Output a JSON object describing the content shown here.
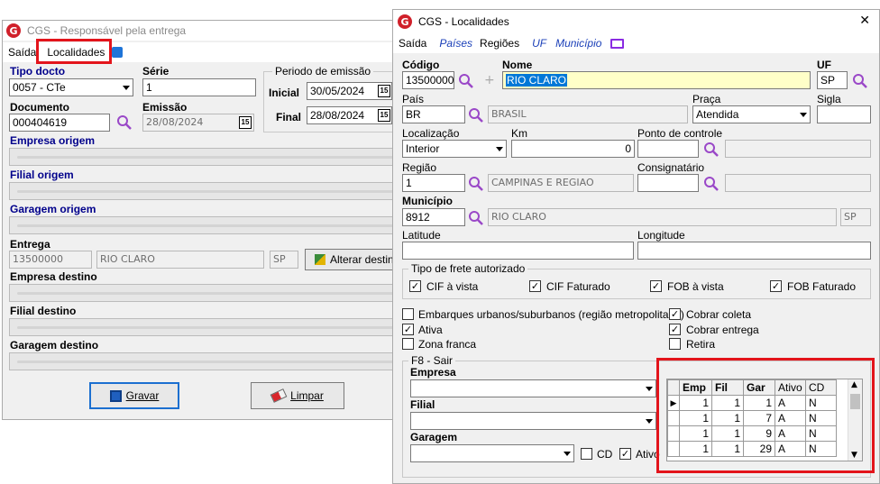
{
  "back": {
    "title": "CGS - Responsável pela entrega",
    "menu": [
      "Saída",
      "Localidades"
    ],
    "tipo_docto": {
      "label": "Tipo docto",
      "value": "0057 - CTe"
    },
    "serie": {
      "label": "Série",
      "value": "1"
    },
    "periodo": {
      "label": "Periodo de emissão",
      "inicial_label": "Inicial",
      "inicial": "30/05/2024",
      "final_label": "Final",
      "final": "28/08/2024"
    },
    "documento": {
      "label": "Documento",
      "value": "000404619"
    },
    "emissao": {
      "label": "Emissão",
      "value": "28/08/2024"
    },
    "empresa_origem": "Empresa origem",
    "filial_origem": "Filial origem",
    "garagem_origem": "Garagem origem",
    "entrega": {
      "label": "Entrega",
      "code": "13500000",
      "city": "RIO CLARO",
      "uf": "SP",
      "button": "Alterar destino"
    },
    "empresa_destino": "Empresa destino",
    "filial_destino": "Filial destino",
    "garagem_destino": "Garagem destino",
    "gravar": "Gravar",
    "limpar": "Limpar",
    "calendar_glyph": "15"
  },
  "front": {
    "title": "CGS - Localidades",
    "close": "✕",
    "menu": [
      {
        "label": "Saída",
        "style": "normal"
      },
      {
        "label": "Países",
        "style": "link"
      },
      {
        "label": "Regiões",
        "style": "normal"
      },
      {
        "label": "UF",
        "style": "link"
      },
      {
        "label": "Município",
        "style": "link"
      }
    ],
    "codigo": {
      "label": "Código",
      "value": "13500000"
    },
    "nome": {
      "label": "Nome",
      "value": "RIO CLARO"
    },
    "uf": {
      "label": "UF",
      "value": "SP"
    },
    "pais": {
      "label": "País",
      "code": "BR",
      "name": "BRASIL"
    },
    "praca": {
      "label": "Praça",
      "value": "Atendida"
    },
    "sigla": {
      "label": "Sigla",
      "value": ""
    },
    "localizacao": {
      "label": "Localização",
      "value": "Interior"
    },
    "km": {
      "label": "Km",
      "value": "0"
    },
    "ponto": {
      "label": "Ponto de controle",
      "value": ""
    },
    "regiao": {
      "label": "Região",
      "code": "1",
      "name": "CAMPINAS E REGIAO"
    },
    "consignatario": {
      "label": "Consignatário",
      "value": ""
    },
    "municipio": {
      "label": "Município",
      "code": "8912",
      "name": "RIO CLARO",
      "uf": "SP"
    },
    "latitude": {
      "label": "Latitude",
      "value": ""
    },
    "longitude": {
      "label": "Longitude",
      "value": ""
    },
    "frete": {
      "title": "Tipo de frete autorizado",
      "items": [
        {
          "label": "CIF à vista",
          "checked": true
        },
        {
          "label": "CIF Faturado",
          "checked": true
        },
        {
          "label": "FOB à vista",
          "checked": true
        },
        {
          "label": "FOB Faturado",
          "checked": true
        }
      ]
    },
    "flags_left": [
      {
        "label": "Embarques urbanos/suburbanos (região metropolitana)",
        "checked": false
      },
      {
        "label": "Ativa",
        "checked": true
      },
      {
        "label": "Zona franca",
        "checked": false
      }
    ],
    "flags_right": [
      {
        "label": "Cobrar coleta",
        "checked": true
      },
      {
        "label": "Cobrar entrega",
        "checked": true
      },
      {
        "label": "Retira",
        "checked": false
      }
    ],
    "f8": {
      "title": "F8 - Sair",
      "empresa": "Empresa",
      "filial": "Filial",
      "garagem": "Garagem",
      "cd": "CD",
      "ativo": "Ativo",
      "cd_checked": false,
      "ativo_checked": true
    },
    "grid": {
      "columns": [
        "Emp",
        "Fil",
        "Gar",
        "Ativo",
        "CD"
      ],
      "rows": [
        [
          "1",
          "1",
          "1",
          "A",
          "N"
        ],
        [
          "1",
          "1",
          "7",
          "A",
          "N"
        ],
        [
          "1",
          "1",
          "9",
          "A",
          "N"
        ],
        [
          "1",
          "1",
          "29",
          "A",
          "N"
        ]
      ]
    },
    "check_glyph": "✓"
  },
  "colors": {
    "highlight": "#e3141b",
    "link": "#1a3fb8",
    "heading": "#00008b",
    "nome_bg": "#ffffc8",
    "selected": "#0078d7"
  }
}
